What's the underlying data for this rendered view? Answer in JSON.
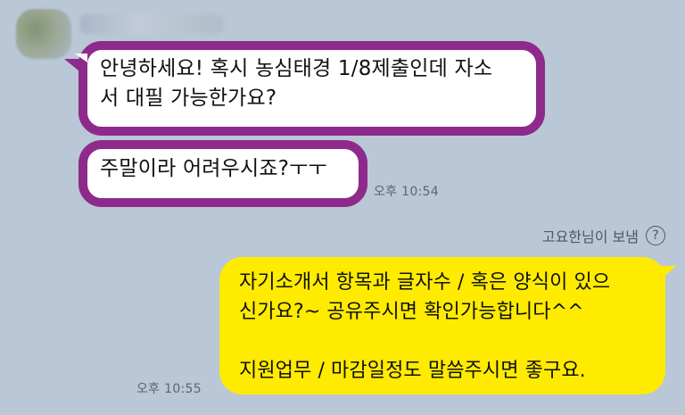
{
  "incoming": {
    "messages": [
      {
        "lines": [
          "안녕하세요! 혹시 농심태경 1/8제출인데 자소",
          "서 대필 가능한가요?"
        ]
      },
      {
        "lines": [
          "주말이라 어려우시죠?ㅜㅜ"
        ]
      }
    ],
    "time": "오후 10:54"
  },
  "outgoing": {
    "sent_by": "고요한님이 보냄",
    "help_icon": "question-circle-icon",
    "lines": [
      "자기소개서 항목과 글자수 / 혹은 양식이 있으",
      "신가요?~ 공유주시면 확인가능합니다^^",
      "",
      "지원업무 / 마감일정도 말씀주시면 좋구요."
    ],
    "time": "오후 10:55",
    "help_glyph": "?"
  },
  "colors": {
    "background": "#b9c7d6",
    "incoming_bubble": "#ffffff",
    "highlight_frame": "#8e2a8b",
    "outgoing_bubble": "#ffeb00"
  }
}
